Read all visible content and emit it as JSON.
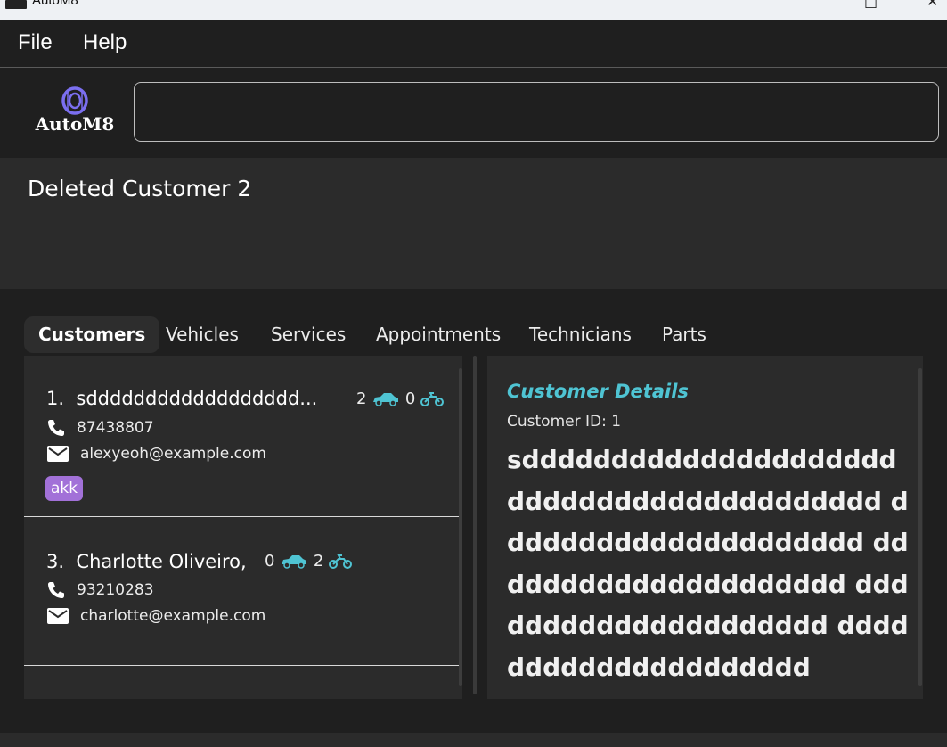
{
  "window": {
    "title": "AutoM8"
  },
  "menu": {
    "file": "File",
    "help": "Help"
  },
  "logo": {
    "text": "AutoM8"
  },
  "command": {
    "value": ""
  },
  "result": {
    "text": "Deleted Customer 2"
  },
  "tabs": [
    {
      "label": "Customers",
      "active": true
    },
    {
      "label": "Vehicles"
    },
    {
      "label": "Services"
    },
    {
      "label": "Appointments"
    },
    {
      "label": "Technicians"
    },
    {
      "label": "Parts"
    }
  ],
  "customers": [
    {
      "index": "1.",
      "name": "sdddddddddddddddddd...",
      "cars": "2",
      "bikes": "0",
      "phone": "87438807",
      "email": "alexyeoh@example.com",
      "tags": [
        "akk"
      ]
    },
    {
      "index": "3.",
      "name": "Charlotte Oliveiro,",
      "cars": "0",
      "bikes": "2",
      "phone": "93210283",
      "email": "charlotte@example.com",
      "tags": []
    }
  ],
  "details": {
    "title": "Customer Details",
    "id_line": "Customer ID: 1",
    "name": "sddddddddddddddddddddd ddddddddddddddddddddd ddddddddddddddddddddd ddddddddddddddddddddd ddddddddddddddddddddd ddddddddddddddddddddd"
  },
  "colors": {
    "accent": "#4fc4d3",
    "tag": "#a271d8",
    "logo_icon": "#7b6ff0"
  }
}
